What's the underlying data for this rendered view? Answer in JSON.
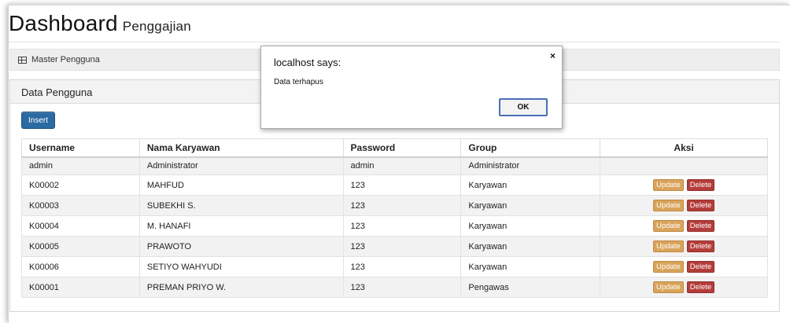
{
  "header": {
    "title": "Dashboard",
    "subtitle": "Penggajian"
  },
  "breadcrumb": {
    "label": "Master Pengguna",
    "icon": "table-icon"
  },
  "panel": {
    "title": "Data Pengguna",
    "insert_label": "Insert"
  },
  "table": {
    "columns": [
      "Username",
      "Nama Karyawan",
      "Password",
      "Group",
      "Aksi"
    ],
    "action_labels": {
      "update": "Update",
      "delete": "Delete"
    },
    "rows": [
      {
        "username": "admin",
        "nama": "Administrator",
        "password": "admin",
        "group": "Administrator",
        "has_actions": false
      },
      {
        "username": "K00002",
        "nama": "MAHFUD",
        "password": "123",
        "group": "Karyawan",
        "has_actions": true
      },
      {
        "username": "K00003",
        "nama": "SUBEKHI S.",
        "password": "123",
        "group": "Karyawan",
        "has_actions": true
      },
      {
        "username": "K00004",
        "nama": "M. HANAFI",
        "password": "123",
        "group": "Karyawan",
        "has_actions": true
      },
      {
        "username": "K00005",
        "nama": "PRAWOTO",
        "password": "123",
        "group": "Karyawan",
        "has_actions": true
      },
      {
        "username": "K00006",
        "nama": "SETIYO WAHYUDI",
        "password": "123",
        "group": "Karyawan",
        "has_actions": true
      },
      {
        "username": "K00001",
        "nama": "PREMAN PRIYO W.",
        "password": "123",
        "group": "Pengawas",
        "has_actions": true
      }
    ]
  },
  "dialog": {
    "title": "localhost says:",
    "message": "Data terhapus",
    "ok_label": "OK",
    "close_label": "×"
  },
  "colors": {
    "insert": "#2b6aa3",
    "update": "#d9a35a",
    "delete": "#b33d3a",
    "ok_border": "#4a6fb5"
  }
}
